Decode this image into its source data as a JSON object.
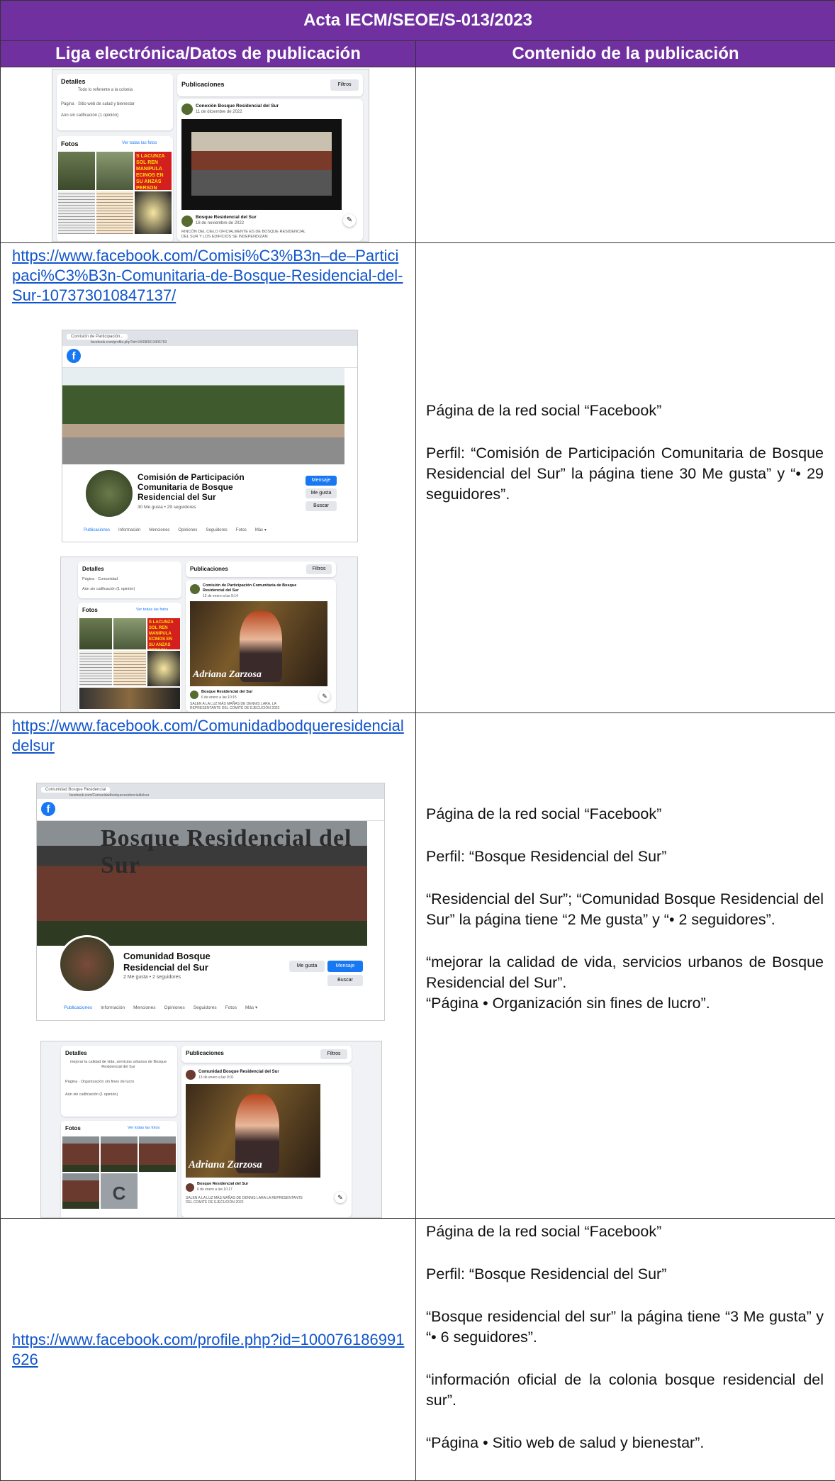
{
  "header": {
    "title": "Acta IECM/SEOE/S-013/2023",
    "col_left": "Liga electrónica/Datos de publicación",
    "col_right": "Contenido de la publicación"
  },
  "rows": [
    {
      "shot": {
        "details_title": "Detalles",
        "details_text": "Todo lo referente a la colonia",
        "page_type": "Página · Sitio web de salud y bienestar",
        "rating": "Aún sin calificación (1 opinión)",
        "photos_title": "Fotos",
        "photos_link": "Ver todas las fotos",
        "posts_title": "Publicaciones",
        "filters": "Filtros",
        "post1_author": "Conexión Bosque Residencial del Sur",
        "post1_date": "11 de diciembre de 2022",
        "post2_author": "Bosque Residencial del Sur",
        "post2_date": "18 de noviembre de 2022",
        "post2_text": "RINCÓN DEL CIELO OFICIALMENTE ES DE BOSQUE RESIDENCIAL DEL SUR Y LOS EDIFICIOS SE INDEPENDIZAN",
        "banner_text": "S LACUNZA SOL REN MANIPULA ECINOS EN SU ANZAS PERSON"
      }
    },
    {
      "link": "https://www.facebook.com/Comisi%C3%B3n–de–Participaci%C3%B3n-Comunitaria-de-Bosque-Residencial-del-Sur-107373010847137/",
      "shot_top": {
        "tab_title": "Comisión de Participación...",
        "url": "facebook.com/profile.php?id=100083013406769",
        "page_name": "Comisión de Participación Comunitaria de Bosque Residencial del Sur",
        "stats": "30 Me gusta • 29 seguidores",
        "btn_message": "Mensaje",
        "btn_like": "Me gusta",
        "btn_search": "Buscar",
        "tabs": [
          "Publicaciones",
          "Información",
          "Menciones",
          "Opiniones",
          "Seguidores",
          "Fotos",
          "Más ▾"
        ]
      },
      "shot_bottom": {
        "details_title": "Detalles",
        "page_type": "Página · Comunidad",
        "rating": "Aún sin calificación (1 opinión)",
        "photos_title": "Fotos",
        "photos_link": "Ver todas las fotos",
        "posts_title": "Publicaciones",
        "filters": "Filtros",
        "post_author": "Comisión de Participación Comunitaria de Bosque Residencial del Sur",
        "post_date": "12 de enero a las 9:14",
        "video_caption": "Adriana Zarzosa",
        "post2_author": "Bosque Residencial del Sur",
        "post2_date": "6 de enero a las 10:15",
        "post2_text": "SALEN A LA LUZ MÁS MAÑAS DE DENNIS LARA, LA REPRESENTANTE DEL COMITÉ DE EJECUCIÓN 2022",
        "banner_text": "S LACUNZA SOL REN MANIPULA ECINOS EN SU ANZAS PERSON"
      },
      "desc": [
        "Página de la red social “Facebook”",
        "Perfil: “Comisión de Participación Comunitaria de Bosque Residencial del Sur” la página tiene 30 Me gusta” y “• 29 seguidores”."
      ]
    },
    {
      "link": "https://www.facebook.com/Comunidadbodqueresidencialdelsur",
      "shot_top": {
        "tab_title": "Comunidad Bosque Residencial",
        "url": "facebook.com/Comunidadbodqueresidencialdelsur",
        "cover_text": "Bosque Residencial del Sur",
        "page_name": "Comunidad Bosque Residencial del Sur",
        "stats": "2 Me gusta • 2 seguidores",
        "btn_like": "Me gusta",
        "btn_message": "Mensaje",
        "btn_search": "Buscar",
        "tabs": [
          "Publicaciones",
          "Información",
          "Menciones",
          "Opiniones",
          "Seguidores",
          "Fotos",
          "Más ▾"
        ]
      },
      "shot_bottom": {
        "details_title": "Detalles",
        "details_text": "mejorar la calidad de vida, servicios urbanos de Bosque Residencial del Sur",
        "page_type": "Página · Organización sin fines de lucro",
        "rating": "Aún sin calificación (1 opinión)",
        "photos_title": "Fotos",
        "photos_link": "Ver todas las fotos",
        "posts_title": "Publicaciones",
        "filters": "Filtros",
        "post_author": "Comunidad Bosque Residencial del Sur",
        "post_date": "13 de enero a las 9:01",
        "video_caption": "Adriana Zarzosa",
        "post2_author": "Bosque Residencial del Sur",
        "post2_date": "6 de enero a las 10:17",
        "post2_text": "SALEN A LA LUZ MÁS MAÑAS DE DENNIS LARA LA REPRESENTANTE DEL COMITÉ DE EJECUCIÓN 2022",
        "avatar_letter": "C"
      },
      "desc": [
        "Página de la red social “Facebook”",
        "Perfil: “Bosque Residencial del Sur”",
        "“Residencial del Sur”; “Comunidad Bosque Residencial del Sur” la página tiene “2 Me gusta” y “• 2 seguidores”.",
        "“mejorar la calidad de vida, servicios urbanos de Bosque Residencial del Sur”.",
        "“Página • Organización sin fines de lucro”."
      ]
    },
    {
      "link": "https://www.facebook.com/profile.php?id=100076186991626",
      "desc": [
        "Página de la red social “Facebook”",
        "Perfil: “Bosque Residencial del Sur”",
        "“Bosque residencial del sur” la página tiene “3 Me gusta” y “• 6 seguidores”.",
        "“información oficial de la colonia bosque residencial del sur”.",
        "“Página • Sitio web de salud y bienestar”."
      ]
    }
  ]
}
